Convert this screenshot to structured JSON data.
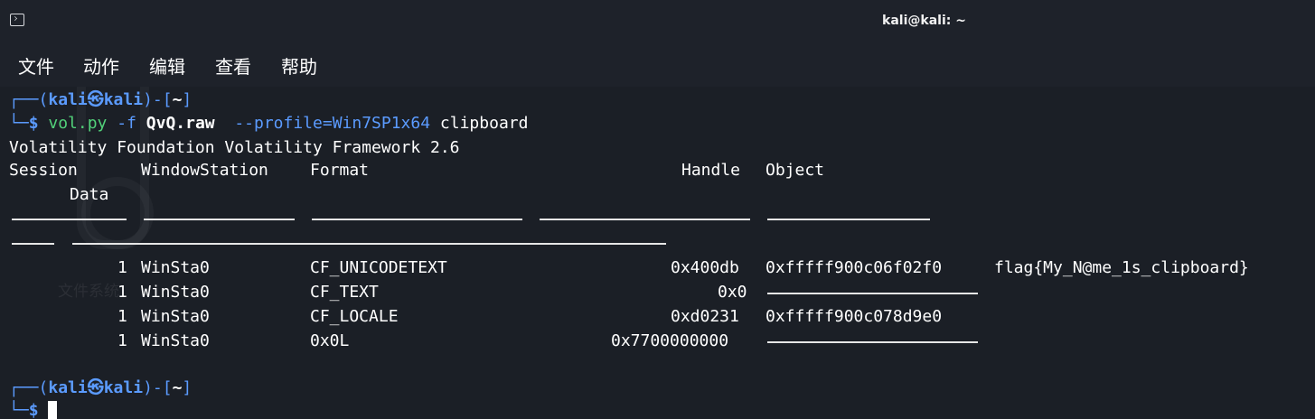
{
  "window": {
    "title": "kali@kali: ~",
    "icon": "terminal-icon"
  },
  "menu": {
    "items": [
      "文件",
      "动作",
      "编辑",
      "查看",
      "帮助"
    ]
  },
  "prompt1": {
    "open": "┌──(",
    "user": "kali㉿kali",
    "close": ")-[",
    "dir": "~",
    "end": "]",
    "corner": "└─",
    "dollar": "$",
    "cmd": "vol.py",
    "flag_f": "-f",
    "file": "QvQ.raw",
    "profile": "--profile=Win7SP1x64",
    "plugin": "clipboard"
  },
  "output": {
    "banner": "Volatility Foundation Volatility Framework 2.6",
    "headers": {
      "session": "Session",
      "windowstation": "WindowStation",
      "format": "Format",
      "handle": "Handle",
      "object": "Object",
      "data": "Data"
    },
    "rows": [
      {
        "session": "1",
        "station": "WinSta0",
        "format": "CF_UNICODETEXT",
        "handle": "0x400db",
        "object": "0xfffff900c06f02f0",
        "data": "flag{My_N@me_1s_clipboard}"
      },
      {
        "session": "1",
        "station": "WinSta0",
        "format": "CF_TEXT",
        "handle": "0x0",
        "object": "",
        "data": ""
      },
      {
        "session": "1",
        "station": "WinSta0",
        "format": "CF_LOCALE",
        "handle": "0xd0231",
        "object": "0xfffff900c078d9e0",
        "data": ""
      },
      {
        "session": "1",
        "station": "WinSta0",
        "format": "0x0L",
        "handle": "0x7700000000",
        "object": "",
        "data": ""
      }
    ]
  },
  "prompt2": {
    "open": "┌──(",
    "user": "kali㉿kali",
    "close": ")-[",
    "dir": "~",
    "end": "]",
    "corner": "└─",
    "dollar": "$"
  },
  "watermark": "文件系统",
  "colors": {
    "background": "#1b1f26",
    "prompt_blue": "#5b9bff",
    "command_green": "#52d17a",
    "text": "#ffffff"
  }
}
